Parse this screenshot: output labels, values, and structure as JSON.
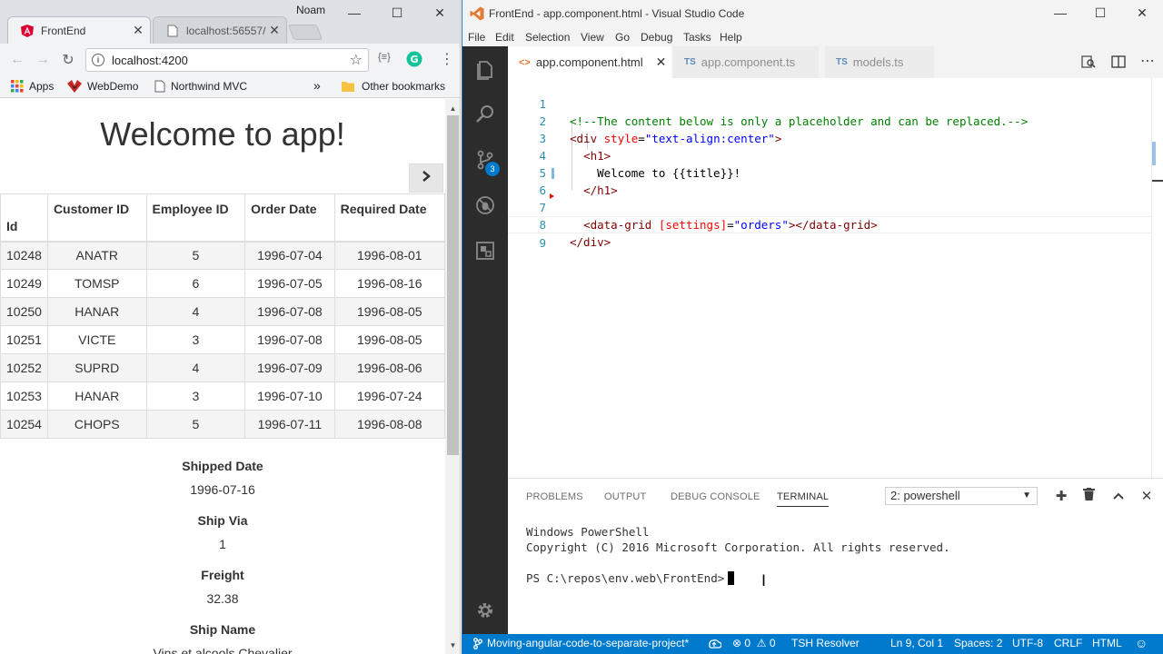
{
  "chrome": {
    "profile": "Noam",
    "tabs": [
      {
        "label": "FrontEnd",
        "active": true
      },
      {
        "label": "localhost:56557/...",
        "active": false
      }
    ],
    "url": "localhost:4200",
    "bookmarks": [
      {
        "label": "Apps",
        "icon": "apps-grid-icon"
      },
      {
        "label": "WebDemo",
        "icon": "webdemo-icon"
      },
      {
        "label": "Northwind MVC",
        "icon": "page-icon"
      }
    ],
    "bookmarks_overflow": "»",
    "other_bookmarks": "Other bookmarks",
    "page": {
      "heading": "Welcome to app!",
      "table": {
        "headers": [
          "Id",
          "Customer ID",
          "Employee ID",
          "Order Date",
          "Required Date"
        ],
        "rows": [
          [
            "10248",
            "ANATR",
            "5",
            "1996-07-04",
            "1996-08-01"
          ],
          [
            "10249",
            "TOMSP",
            "6",
            "1996-07-05",
            "1996-08-16"
          ],
          [
            "10250",
            "HANAR",
            "4",
            "1996-07-08",
            "1996-08-05"
          ],
          [
            "10251",
            "VICTE",
            "3",
            "1996-07-08",
            "1996-08-05"
          ],
          [
            "10252",
            "SUPRD",
            "4",
            "1996-07-09",
            "1996-08-06"
          ],
          [
            "10253",
            "HANAR",
            "3",
            "1996-07-10",
            "1996-07-24"
          ],
          [
            "10254",
            "CHOPS",
            "5",
            "1996-07-11",
            "1996-08-08"
          ]
        ]
      },
      "details": [
        {
          "label": "Shipped Date",
          "value": "1996-07-16"
        },
        {
          "label": "Ship Via",
          "value": "1"
        },
        {
          "label": "Freight",
          "value": "32.38"
        },
        {
          "label": "Ship Name",
          "value": "Vins et alcools Chevalier"
        }
      ]
    }
  },
  "vscode": {
    "title": "FrontEnd - app.component.html - Visual Studio Code",
    "menu": [
      "File",
      "Edit",
      "Selection",
      "View",
      "Go",
      "Debug",
      "Tasks",
      "Help"
    ],
    "scm_badge": "3",
    "tabs": [
      {
        "label": "app.component.html",
        "type": "<>",
        "active": true
      },
      {
        "label": "app.component.ts",
        "type": "TS",
        "active": false
      },
      {
        "label": "models.ts",
        "type": "TS",
        "active": false
      }
    ],
    "code_lines": [
      {
        "n": "1",
        "text": "<!--The content below is only a placeholder and can be replaced.-->"
      },
      {
        "n": "2",
        "text": "<div style=\"text-align:center\">"
      },
      {
        "n": "3",
        "text": "  <h1>"
      },
      {
        "n": "4",
        "text": "    Welcome to {{title}}!"
      },
      {
        "n": "5",
        "text": "  </h1>"
      },
      {
        "n": "6",
        "text": "  <data-grid [settings]=\"orders\"></data-grid>"
      },
      {
        "n": "7",
        "text": "</div>"
      },
      {
        "n": "8",
        "text": ""
      },
      {
        "n": "9",
        "text": ""
      }
    ],
    "panel": {
      "tabs": [
        "PROBLEMS",
        "OUTPUT",
        "DEBUG CONSOLE",
        "TERMINAL"
      ],
      "active_tab": "TERMINAL",
      "terminal_select": "2: powershell",
      "terminal_lines": [
        "Windows PowerShell",
        "Copyright (C) 2016 Microsoft Corporation. All rights reserved.",
        "",
        "PS C:\\repos\\env.web\\FrontEnd>"
      ]
    },
    "status": {
      "branch": "Moving-angular-code-to-separate-project*",
      "errors": "0",
      "warnings": "0",
      "resolver": "TSH Resolver",
      "position": "Ln 9, Col 1",
      "spaces": "Spaces: 2",
      "encoding": "UTF-8",
      "eol": "CRLF",
      "language": "HTML"
    }
  },
  "colors": {
    "vscode_accent": "#007acc",
    "activity_bar": "#2c2c2c",
    "chrome_frame": "#dee1e6",
    "angular_red": "#dd0031",
    "grammarly_green": "#15c39a"
  }
}
